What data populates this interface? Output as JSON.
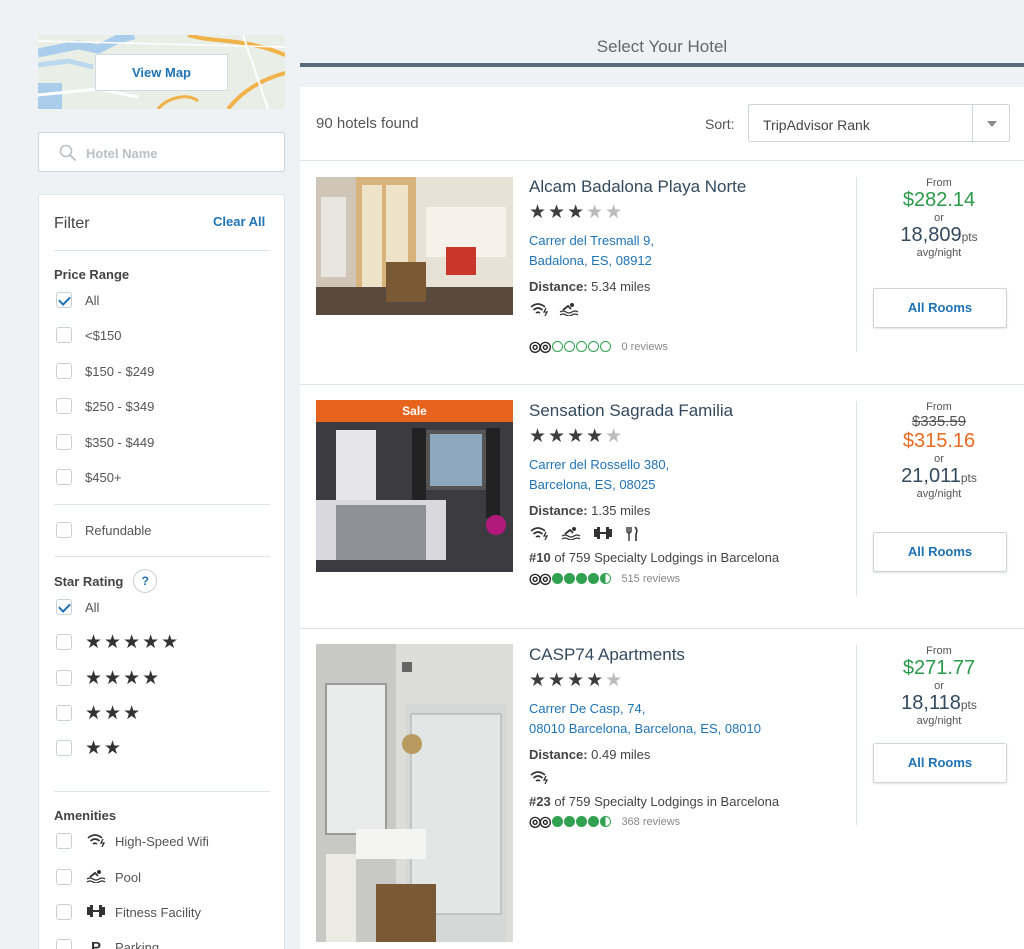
{
  "sidebar": {
    "view_map_label": "View Map",
    "search_placeholder": "Hotel Name",
    "filter": {
      "title": "Filter",
      "clear_all": "Clear All",
      "price_range": {
        "heading": "Price Range",
        "options": [
          {
            "label": "All",
            "checked": true
          },
          {
            "label": "<$150",
            "checked": false
          },
          {
            "label": "$150 - $249",
            "checked": false
          },
          {
            "label": "$250 - $349",
            "checked": false
          },
          {
            "label": "$350 - $449",
            "checked": false
          },
          {
            "label": "$450+",
            "checked": false
          }
        ]
      },
      "refundable": {
        "label": "Refundable",
        "checked": false
      },
      "star_rating": {
        "heading": "Star Rating",
        "help": "?",
        "all_label": "All",
        "options": [
          "★★★★★",
          "★★★★",
          "★★★",
          "★★"
        ]
      },
      "amenities": {
        "heading": "Amenities",
        "options": [
          {
            "label": "High-Speed Wifi",
            "icon": "wifi-icon"
          },
          {
            "label": "Pool",
            "icon": "pool-icon"
          },
          {
            "label": "Fitness Facility",
            "icon": "dumbbell-icon"
          },
          {
            "label": "Parking",
            "icon": "parking-icon",
            "glyph": "P"
          }
        ]
      }
    }
  },
  "main": {
    "title": "Select Your Hotel",
    "count": "90 hotels found",
    "sort_label": "Sort:",
    "sort_value": "TripAdvisor Rank",
    "hotels": [
      {
        "name": "Alcam Badalona Playa Norte",
        "stars_filled": 3,
        "address_line1": "Carrer del Tresmall 9,",
        "address_line2": "Badalona, ES, 08912",
        "distance_label": "Distance:",
        "distance_value": "5.34 miles",
        "amenities": [
          "wifi-icon",
          "pool-icon"
        ],
        "rank": "",
        "rating_circles": 0,
        "reviews": "0 reviews",
        "sale": false,
        "from": "From",
        "old_price": "",
        "price": "$282.14",
        "or": "or",
        "points": "18,809",
        "points_unit": "pts",
        "avg": "avg/night",
        "button": "All Rooms"
      },
      {
        "name": "Sensation Sagrada Familia",
        "stars_filled": 4,
        "address_line1": "Carrer del Rossello 380,",
        "address_line2": "Barcelona, ES, 08025",
        "distance_label": "Distance:",
        "distance_value": "1.35 miles",
        "amenities": [
          "wifi-icon",
          "pool-icon",
          "dumbbell-icon",
          "restaurant-icon"
        ],
        "rank_num": "#10",
        "rank_text": " of 759 Specialty Lodgings in Barcelona",
        "rating_circles": 4.5,
        "reviews": "515 reviews",
        "sale": true,
        "sale_label": "Sale",
        "from": "From",
        "old_price": "$335.59",
        "price": "$315.16",
        "or": "or",
        "points": "21,011",
        "points_unit": "pts",
        "avg": "avg/night",
        "button": "All Rooms"
      },
      {
        "name": "CASP74 Apartments",
        "stars_filled": 4,
        "address_line1": "Carrer De Casp, 74,",
        "address_line2": "08010 Barcelona, Barcelona, ES, 08010",
        "distance_label": "Distance:",
        "distance_value": "0.49 miles",
        "amenities": [
          "wifi-icon"
        ],
        "rank_num": "#23",
        "rank_text": " of 759 Specialty Lodgings in Barcelona",
        "rating_circles": 4.5,
        "reviews": "368 reviews",
        "sale": false,
        "from": "From",
        "old_price": "",
        "price": "$271.77",
        "or": "or",
        "points": "18,118",
        "points_unit": "pts",
        "avg": "avg/night",
        "button": "All Rooms"
      }
    ]
  },
  "colors": {
    "accent": "#1f73b7",
    "price_green": "#2a9a4a",
    "sale_orange": "#e8641e",
    "header_bar": "#5b6a7a"
  }
}
